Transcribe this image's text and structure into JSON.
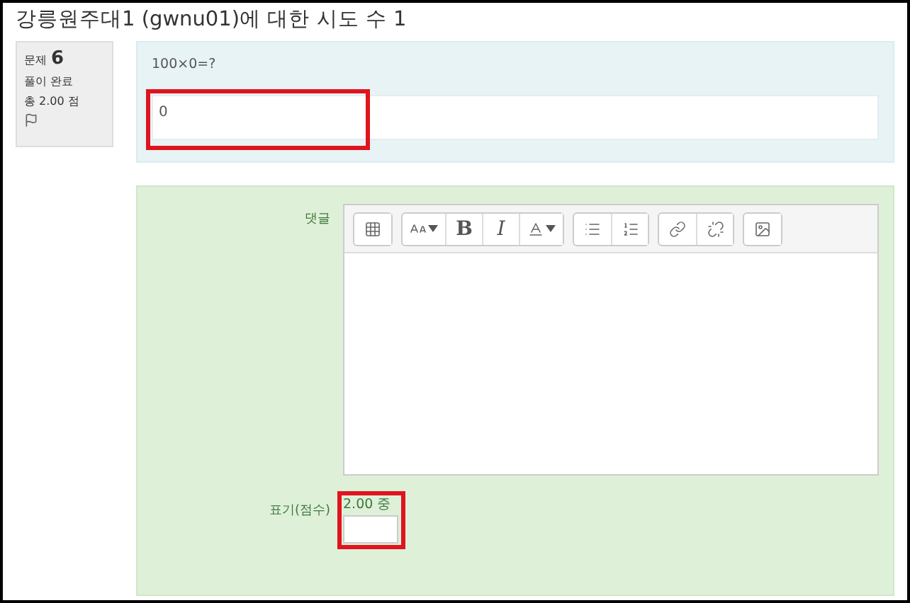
{
  "title": "강릉원주대1 (gwnu01)에 대한 시도 수 1",
  "info": {
    "question_label": "문제",
    "question_number": "6",
    "status": "풀이 완료",
    "score": "총 2.00 점"
  },
  "question": {
    "text": "100×0=?",
    "answer": "0"
  },
  "comment": {
    "label": "댓글",
    "toolbar": [
      {
        "buttons": [
          {
            "kind": "icon"
          }
        ]
      },
      {
        "buttons": [
          {
            "kind": "icon",
            "dropdown": true
          },
          {
            "kind": "text",
            "label": "B"
          },
          {
            "kind": "text",
            "label": "I"
          },
          {
            "kind": "icon",
            "dropdown": true
          }
        ]
      },
      {
        "buttons": [
          {
            "kind": "icon"
          },
          {
            "kind": "icon"
          }
        ]
      },
      {
        "buttons": [
          {
            "kind": "icon"
          },
          {
            "kind": "icon"
          }
        ]
      },
      {
        "buttons": [
          {
            "kind": "icon"
          }
        ]
      }
    ]
  },
  "mark": {
    "label": "표기(점수)",
    "out_of": "2.00 중"
  }
}
